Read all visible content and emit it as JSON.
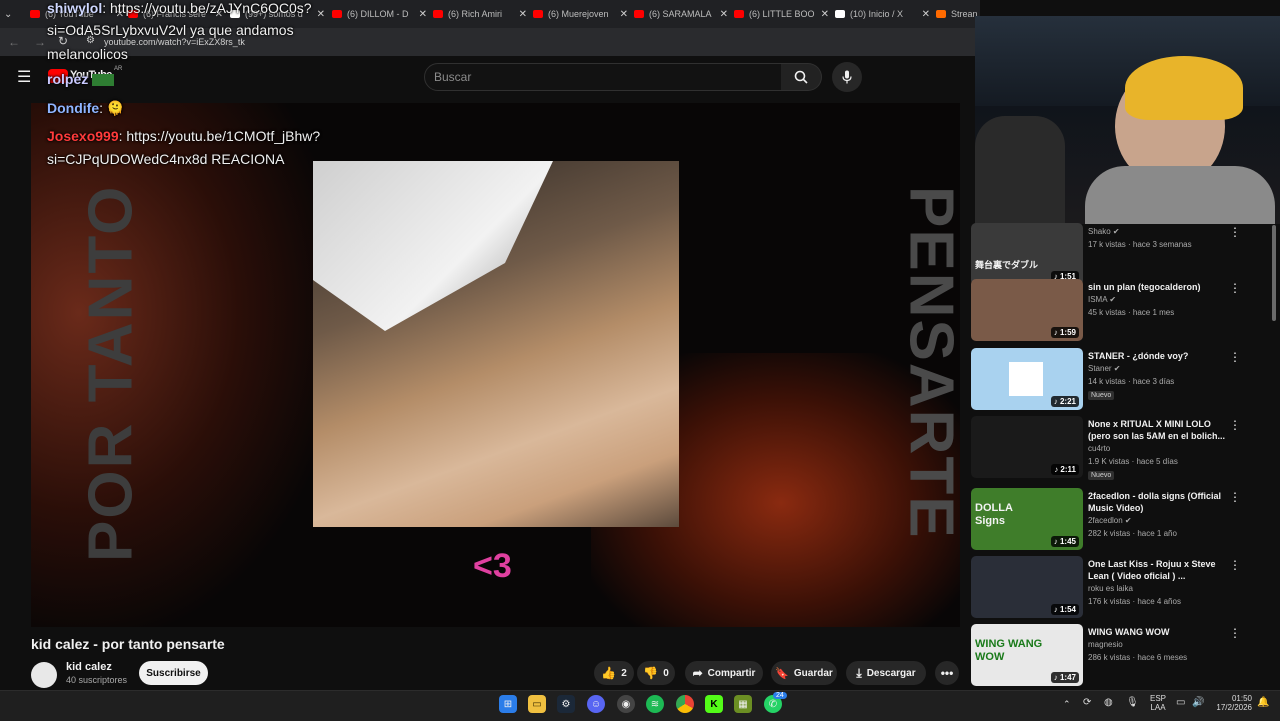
{
  "browser": {
    "tabs": [
      {
        "label": "(6) YouTube",
        "color": "#ff0000"
      },
      {
        "label": "(6) Francis sere",
        "color": "#ff0000"
      },
      {
        "label": "(99+) somos d",
        "color": "#ffffff"
      },
      {
        "label": "(6) DILLOM - D",
        "color": "#ff0000"
      },
      {
        "label": "(6) Rich Amiri",
        "color": "#ff0000"
      },
      {
        "label": "(6) Muerejoven",
        "color": "#ff0000"
      },
      {
        "label": "(6) SARAMALA",
        "color": "#ff0000"
      },
      {
        "label": "(6) LITTLE BOO",
        "color": "#ff0000"
      },
      {
        "label": "(10) Inicio / X",
        "color": "#ffffff"
      },
      {
        "label": "Strean",
        "color": "#ff6a00"
      }
    ],
    "url": "youtube.com/watch?v=iExZX8rs_tk"
  },
  "youtube": {
    "logo": "YouTube",
    "region": "AR",
    "search_placeholder": "Buscar"
  },
  "chat": [
    {
      "user": "shiwylol",
      "user_color": "#cfd8ff",
      "text": ": https://youtu.be/zAJYnC6OC0s?"
    },
    {
      "user": "",
      "user_color": "#ffffff",
      "text": "si=OdA5SrLybxvuV2vl ya que andamos"
    },
    {
      "user": "",
      "user_color": "#ffffff",
      "text": "melancolicos"
    },
    {
      "user": "rolpez",
      "user_color": "#c9c9ff",
      "text": ""
    },
    {
      "user": "Dondife",
      "user_color": "#8fb4ff",
      "text": ": 🫠"
    },
    {
      "user": "Josexo999",
      "user_color": "#ff3b3b",
      "text": ": https://youtu.be/1CMOtf_jBhw?"
    },
    {
      "user": "",
      "user_color": "#ffffff",
      "text": "si=CJPqUDOWedC4nx8d REACIONA"
    }
  ],
  "video": {
    "side_text_left": "POR TANTO",
    "side_text_right": "PENSARTE",
    "heart_text": "<3",
    "title": "kid calez - por tanto pensarte",
    "channel": "kid calez",
    "subscribers": "40 suscriptores",
    "subscribe_label": "Suscribirse",
    "likes": "2",
    "dislikes": "0",
    "share_label": "Compartir",
    "save_label": "Guardar",
    "download_label": "Descargar"
  },
  "recommendations": [
    {
      "title": "",
      "channel": "Shako",
      "meta": "17 k vistas · hace 3 semanas",
      "duration": "1:51",
      "badge": "",
      "verified": true,
      "thumb": "#3a3a3a",
      "overlay_text": "舞台裏でダブル"
    },
    {
      "title": "sin un plan (tegocalderon)",
      "channel": "ISMA",
      "meta": "45 k vistas · hace 1 mes",
      "duration": "1:59",
      "badge": "",
      "verified": true,
      "thumb": "#7a5a48",
      "overlay_text": ""
    },
    {
      "title": "STANER - ¿dónde voy?",
      "channel": "Staner",
      "meta": "14 k vistas · hace 3 días",
      "duration": "2:21",
      "badge": "Nuevo",
      "verified": true,
      "thumb": "#a9d2ef",
      "overlay_text": ""
    },
    {
      "title": "None x RITUAL X MINI LOLO (pero son las 5AM en el bolich...",
      "channel": "cu4rto",
      "meta": "1.9 K vistas · hace 5 días",
      "duration": "2:11",
      "badge": "Nuevo",
      "verified": false,
      "thumb": "#1a1a1a",
      "overlay_text": ""
    },
    {
      "title": "2facedlon - dolla signs (Official Music Video)",
      "channel": "2facedlon",
      "meta": "282 k vistas · hace 1 año",
      "duration": "1:45",
      "badge": "",
      "verified": true,
      "thumb": "#3f7d2a",
      "overlay_text": "DOLLA Signs"
    },
    {
      "title": "One Last Kiss - Rojuu x Steve Lean ( Video oficial ) ...",
      "channel": "roku es laika",
      "meta": "176 k vistas · hace 4 años",
      "duration": "1:54",
      "badge": "",
      "verified": false,
      "thumb": "#2a2e38",
      "overlay_text": ""
    },
    {
      "title": "WING WANG WOW",
      "channel": "magnesio",
      "meta": "286 k vistas · hace 6 meses",
      "duration": "1:47",
      "badge": "",
      "verified": false,
      "thumb": "#e8e8e8",
      "overlay_text": "WING WANG WOW"
    }
  ],
  "taskbar": {
    "whatsapp_badge": "24",
    "lang_top": "ESP",
    "lang_bottom": "LAA",
    "time": "01:50",
    "date": "17/2/2026"
  }
}
